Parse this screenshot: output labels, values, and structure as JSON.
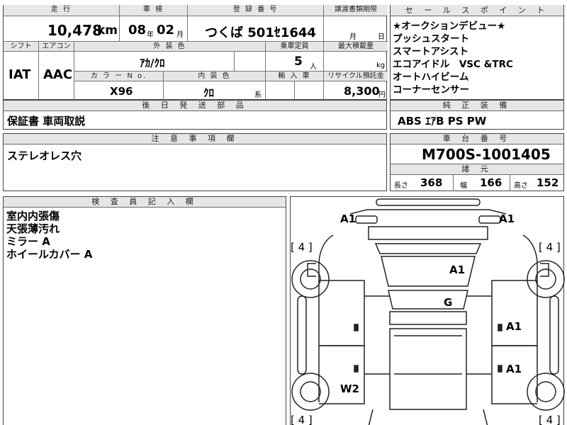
{
  "top_table": {
    "mileage_label": "走 行",
    "mileage_value": "10,478",
    "mileage_unit": "km",
    "inspection_label": "車 検",
    "inspection_year": "08",
    "inspection_year_unit": "年",
    "inspection_month": "02",
    "inspection_month_unit": "月",
    "registration_label": "登 録 番 号",
    "registration_value": "つくば 501ｾ1644",
    "transfer_label": "譲渡書類期限",
    "transfer_month": "月",
    "transfer_day": "日",
    "shift_label": "シフト",
    "aircon_label": "エアコン",
    "ext_color_label": "外 装 色",
    "capacity_label": "乗車定員",
    "max_load_label": "最大積載量",
    "shift_value": "IAT",
    "aircon_value": "AAC",
    "ext_color_value": "ｱｶ/ｸﾛ",
    "capacity_value": "5",
    "capacity_unit": "人",
    "load_unit": "kg",
    "color_no_label": "カ ラ ー N o.",
    "int_color_label": "内 装 色",
    "import_label": "輸 入 車",
    "recycle_label": "リサイクル預託金",
    "color_no_value": "X96",
    "int_color_value": "ｸﾛ",
    "int_color_suffix": "系",
    "recycle_value": "8,300",
    "recycle_unit": "円",
    "later_parts_label": "後 日 発 送 部 品",
    "later_parts_value": "保証書 車両取説",
    "notice_label": "注 意 事 項 欄",
    "notice_value": "ステレオレス穴"
  },
  "right_panel": {
    "sales_label": "セ ー ル ス ポ イ ン ト",
    "sales_points": [
      "★オークションデビュー★",
      "プッシュスタート",
      "スマートアシスト",
      "エコアイドル　VSC &TRC",
      "オートハイビーム",
      "コーナーセンサー"
    ],
    "equipment_label": "純 正 装 備",
    "equipment_value": "ABS ｴｱB PS PW",
    "chassis_label": "車 台 番 号",
    "chassis_value": "M700S-1001405",
    "specs_label": "諸 元",
    "length_label": "長さ",
    "length_value": "368",
    "width_label": "幅",
    "width_value": "166",
    "height_label": "高さ",
    "height_value": "152"
  },
  "inspector": {
    "label": "検 査 員 記 入 欄",
    "notes": [
      "室内内張傷",
      "天張薄汚れ",
      "ミラー A",
      "ホイールカバー A"
    ]
  },
  "diagram": {
    "marks": {
      "front_left": "A1",
      "front_right": "A1",
      "roof": "A1",
      "glass": "G",
      "right_front_door": "A1",
      "right_rear_door": "A1",
      "left_rear": "W2"
    },
    "tire_depth": [
      "[ 4 ]",
      "[ 4 ]",
      "[ 4 ]",
      "[ 4 ]"
    ]
  }
}
